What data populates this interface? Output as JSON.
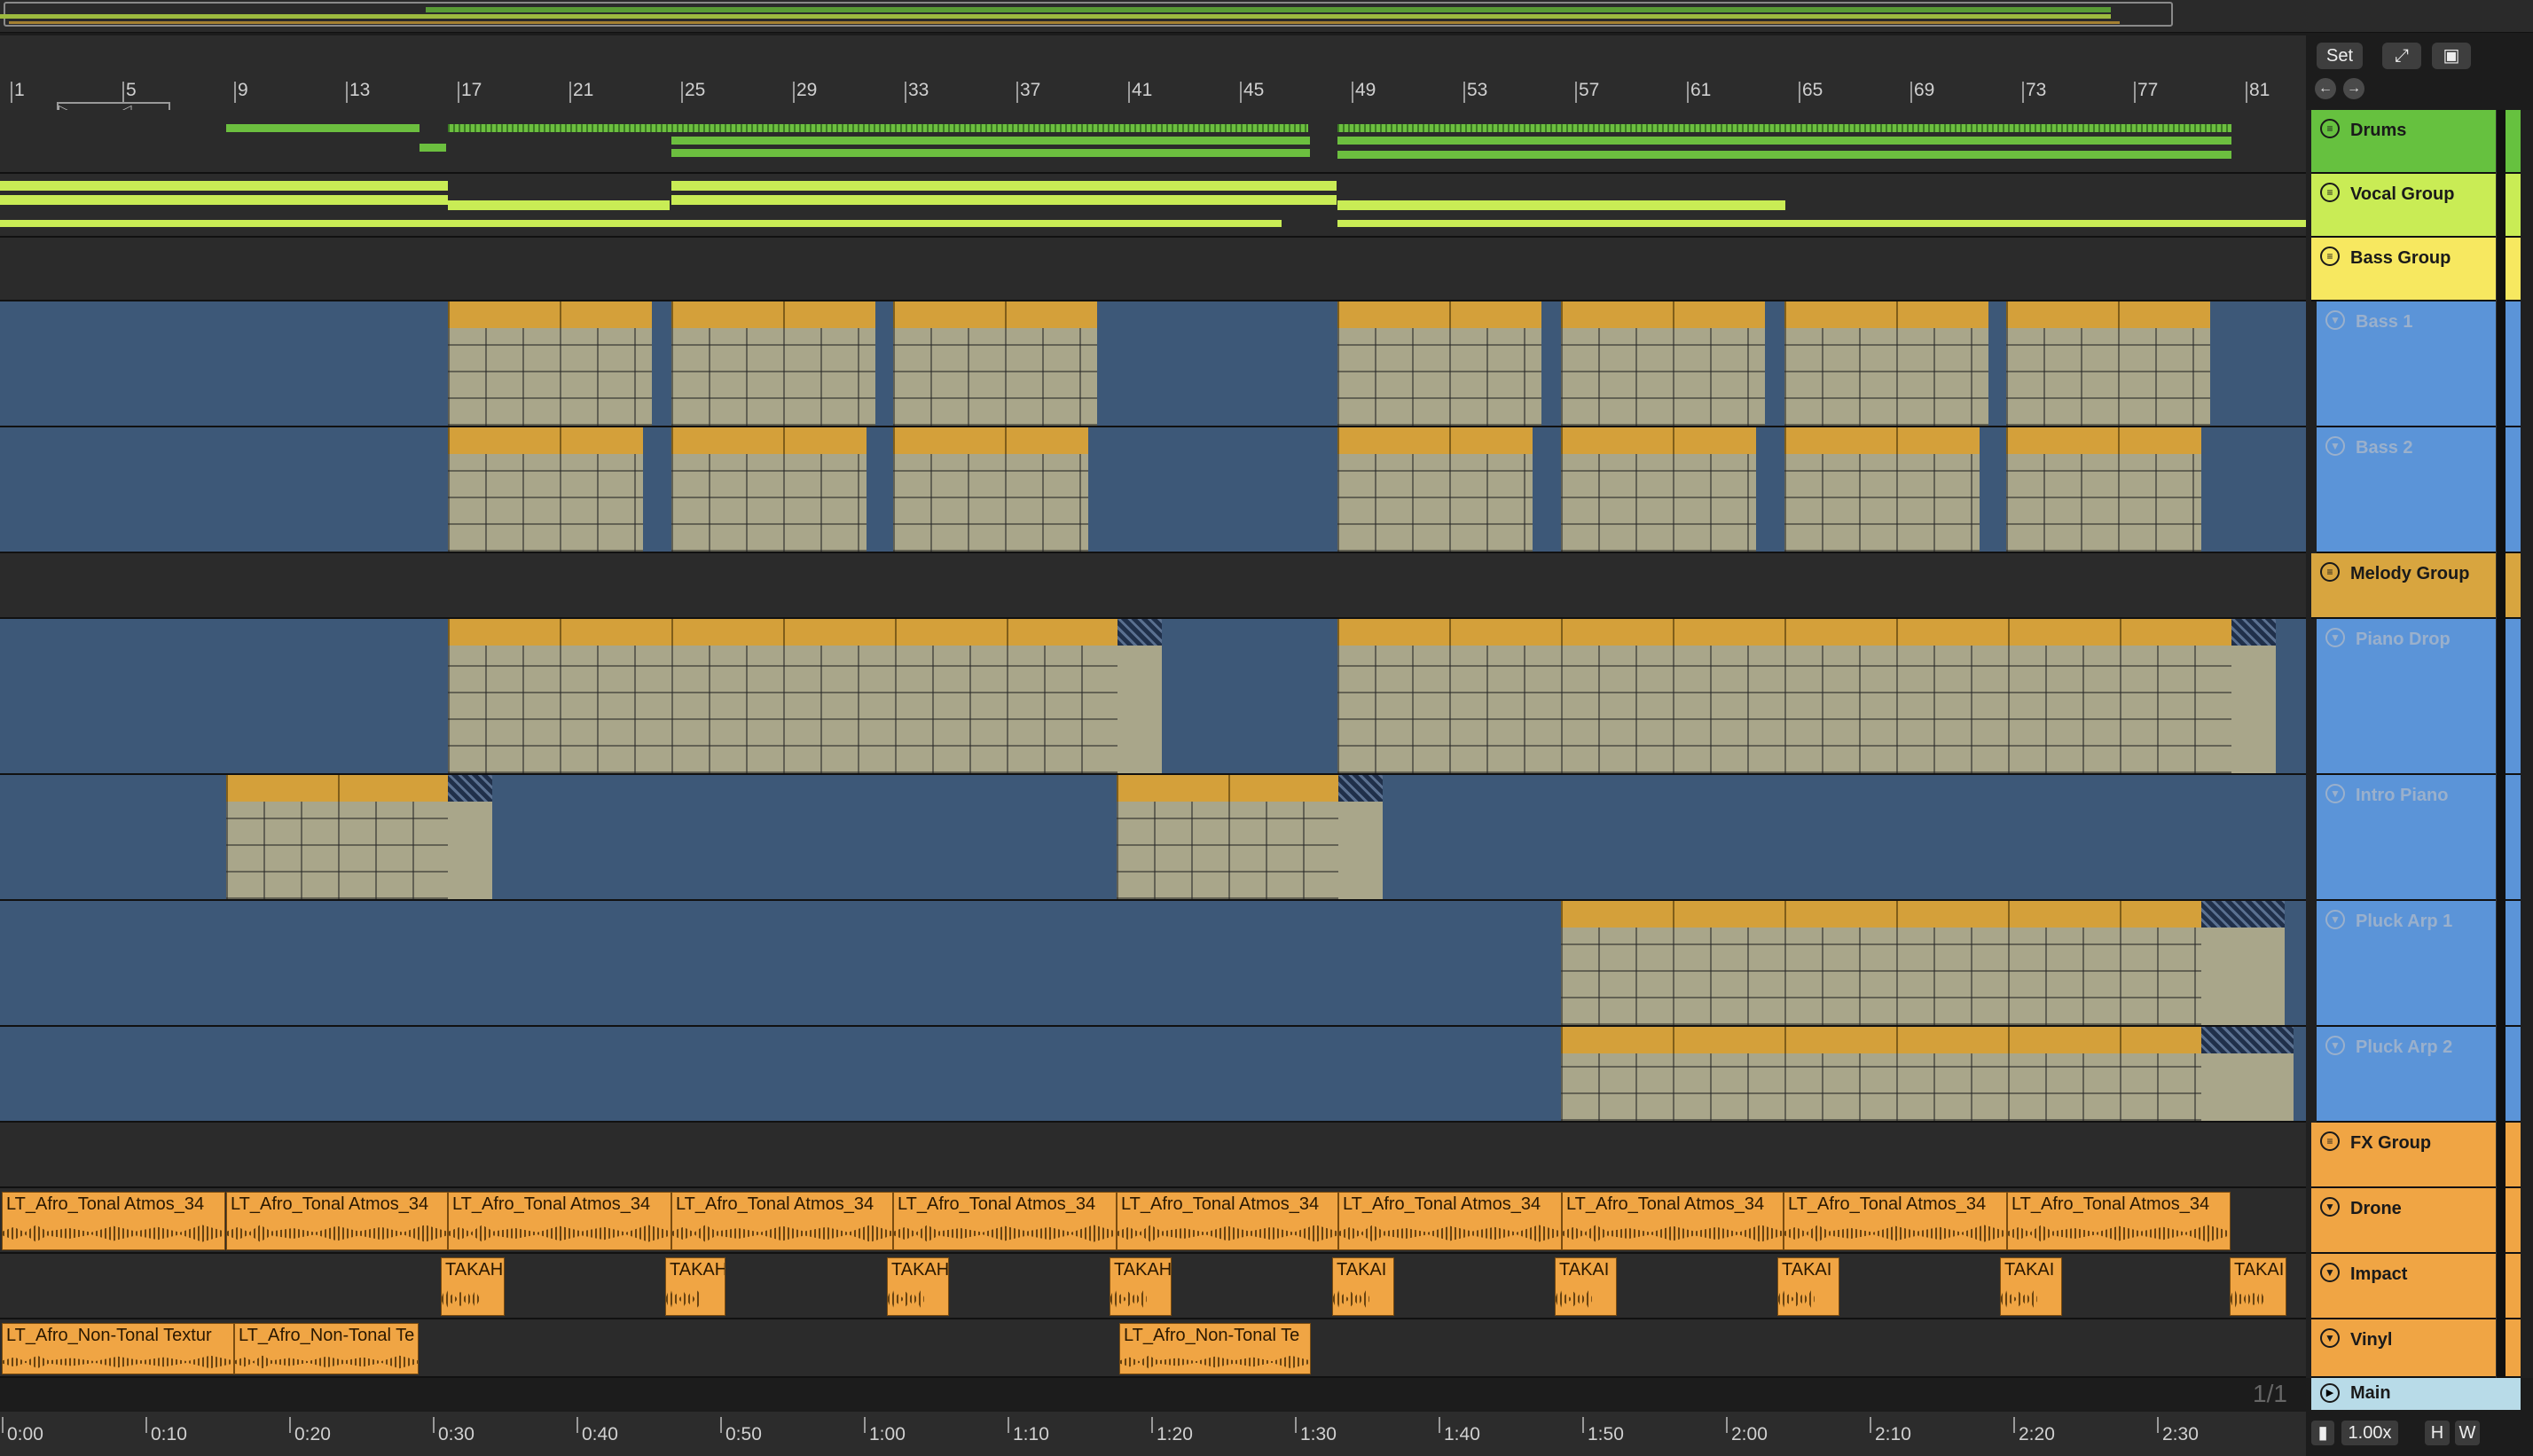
{
  "ruler": {
    "bars": [
      "1",
      "5",
      "9",
      "13",
      "17",
      "21",
      "25",
      "29",
      "33",
      "37",
      "41",
      "45",
      "49",
      "53",
      "57",
      "61",
      "65",
      "69",
      "73",
      "77",
      "81"
    ]
  },
  "controls": {
    "set_label": "Set",
    "expand_icon": "expand-icon",
    "lock_icon": "lock-icon",
    "back_icon": "arrow-left-icon",
    "forward_icon": "arrow-right-icon"
  },
  "tracks": [
    {
      "name": "Drums",
      "kind": "group",
      "color": "#66c13f"
    },
    {
      "name": "Vocal Group",
      "kind": "group",
      "color": "#c9ec55"
    },
    {
      "name": "Bass Group",
      "kind": "group",
      "color": "#f7e860"
    },
    {
      "name": "Bass 1",
      "kind": "midi",
      "color": "#5b94d8"
    },
    {
      "name": "Bass 2",
      "kind": "midi",
      "color": "#5b94d8"
    },
    {
      "name": "Melody Group",
      "kind": "group",
      "color": "#d8a53f"
    },
    {
      "name": "Piano Drop",
      "kind": "midi",
      "color": "#5b94d8"
    },
    {
      "name": "Intro Piano",
      "kind": "midi",
      "color": "#5b94d8"
    },
    {
      "name": "Pluck Arp 1",
      "kind": "midi",
      "color": "#5b94d8"
    },
    {
      "name": "Pluck Arp 2",
      "kind": "midi",
      "color": "#5b94d8"
    },
    {
      "name": "FX Group",
      "kind": "group",
      "color": "#f0a544"
    },
    {
      "name": "Drone",
      "kind": "audio",
      "color": "#f0a544"
    },
    {
      "name": "Impact",
      "kind": "audio",
      "color": "#f0a544"
    },
    {
      "name": "Vinyl",
      "kind": "audio",
      "color": "#f0a544"
    }
  ],
  "main_track": {
    "name": "Main",
    "color": "#b8dbe8"
  },
  "clips": {
    "drone_label": "LT_Afro_Tonal Atmos_34",
    "impact_label": "TAKAH",
    "impact_label_clipped": "TAKAI",
    "vinyl_label_1": "LT_Afro_Non-Tonal Textur",
    "vinyl_label_2": "LT_Afro_Non-Tonal Te",
    "vinyl_label_3": "LT_Afro_Non-Tonal Te"
  },
  "timeline": {
    "labels": [
      "0:00",
      "0:10",
      "0:20",
      "0:30",
      "0:40",
      "0:50",
      "1:00",
      "1:10",
      "1:20",
      "1:30",
      "1:40",
      "1:50",
      "2:00",
      "2:10",
      "2:20",
      "2:30"
    ]
  },
  "footer": {
    "pager": "1/1",
    "zoom": "1.00x",
    "h_label": "H",
    "w_label": "W"
  }
}
